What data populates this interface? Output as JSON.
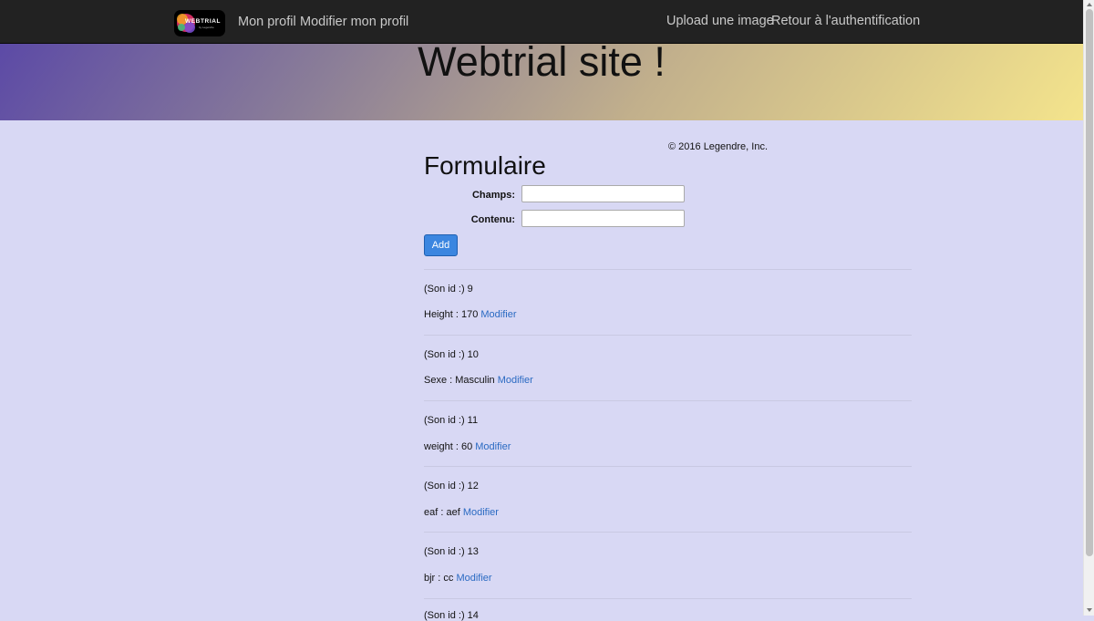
{
  "nav": {
    "logo_text": "WEBTRIAL",
    "logo_sub": "by Legendre",
    "left_links": [
      "Mon profil",
      "Modifier mon profil"
    ],
    "right_links": [
      "Upload une image",
      "Retour à l'authentification"
    ]
  },
  "hero": {
    "title": "Webtrial site !"
  },
  "footer": {
    "copyright": "© 2016 Legendre, Inc."
  },
  "form": {
    "title": "Formulaire",
    "champs_label": "Champs:",
    "champs_value": "",
    "contenu_label": "Contenu:",
    "contenu_value": "",
    "add_label": "Add"
  },
  "records": [
    {
      "id_text": "(Son id :) 9",
      "text": "Height : 170",
      "link": "Modifier"
    },
    {
      "id_text": "(Son id :) 10",
      "text": "Sexe : Masculin",
      "link": "Modifier"
    },
    {
      "id_text": "(Son id :) 11",
      "text": "weight : 60",
      "link": "Modifier"
    },
    {
      "id_text": "(Son id :) 12",
      "text": "eaf : aef",
      "link": "Modifier"
    },
    {
      "id_text": "(Son id :) 13",
      "text": "bjr : cc",
      "link": "Modifier"
    },
    {
      "id_text": "(Son id :) 14",
      "text": "",
      "link": ""
    }
  ],
  "colors": {
    "navbar": "#222222",
    "page_bg": "#d8d8f4",
    "link": "#2a6ac2",
    "button": "#3b86e0"
  }
}
